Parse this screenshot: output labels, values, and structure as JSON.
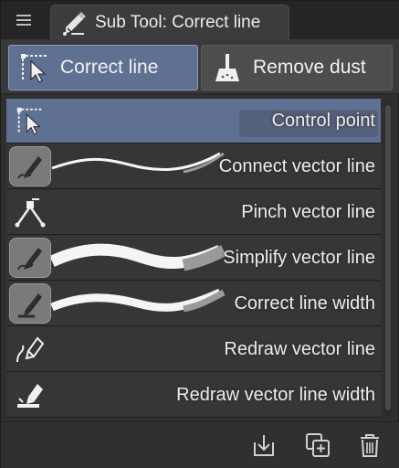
{
  "header": {
    "title": "Sub Tool: Correct line",
    "menu_icon": "hamburger-icon",
    "tab_icon": "correct-line-tool-icon"
  },
  "groups": [
    {
      "label": "Correct line",
      "icon": "control-point-icon",
      "selected": true
    },
    {
      "label": "Remove dust",
      "icon": "dust-pan-icon",
      "selected": false
    }
  ],
  "tools": [
    {
      "label": "Control point",
      "icon": "control-point-icon",
      "selected": true
    },
    {
      "label": "Connect vector line",
      "icon": "pen-icon"
    },
    {
      "label": "Pinch vector line",
      "icon": "pinch-icon"
    },
    {
      "label": "Simplify vector line",
      "icon": "pen-icon"
    },
    {
      "label": "Correct line width",
      "icon": "pen-icon"
    },
    {
      "label": "Redraw vector line",
      "icon": "redraw-icon"
    },
    {
      "label": "Redraw vector line width",
      "icon": "redraw-width-icon"
    }
  ],
  "footer": {
    "export_icon": "download-icon",
    "duplicate_icon": "duplicate-icon",
    "delete_icon": "trash-icon"
  },
  "colors": {
    "selected": "#5f7192",
    "panel": "#2f2f2f",
    "row": "#363636"
  }
}
